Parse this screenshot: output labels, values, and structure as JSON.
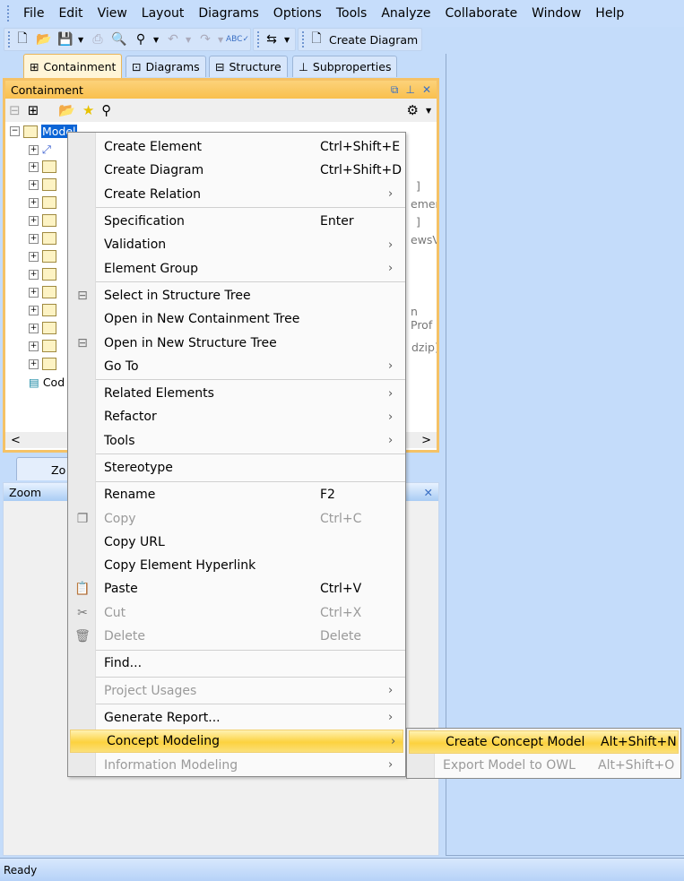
{
  "menubar": [
    "File",
    "Edit",
    "View",
    "Layout",
    "Diagrams",
    "Options",
    "Tools",
    "Analyze",
    "Collaborate",
    "Window",
    "Help"
  ],
  "toolbar": {
    "create_diagram": "Create Diagram"
  },
  "tabs": [
    "Containment",
    "Diagrams",
    "Structure",
    "Subproperties"
  ],
  "panel": {
    "title": "Containment",
    "tree": {
      "root": "Model",
      "last": "Cod"
    },
    "fragments": [
      "]",
      "ement",
      "]",
      "ewsVie",
      "n Prof",
      "dzip]"
    ]
  },
  "zoom": {
    "tab": "Zo",
    "title": "Zoom"
  },
  "status": "Ready",
  "context_menu": [
    {
      "label": "Create Element",
      "shortcut": "Ctrl+Shift+E"
    },
    {
      "label": "Create Diagram",
      "shortcut": "Ctrl+Shift+D"
    },
    {
      "label": "Create Relation",
      "submenu": true
    },
    {
      "sep": true
    },
    {
      "label": "Specification",
      "shortcut": "Enter"
    },
    {
      "label": "Validation",
      "submenu": true
    },
    {
      "label": "Element Group",
      "submenu": true
    },
    {
      "sep": true
    },
    {
      "label": "Select in Structure Tree",
      "icon": "structure-tree-icon"
    },
    {
      "label": "Open in New Containment Tree"
    },
    {
      "label": "Open in New Structure Tree",
      "icon": "structure-tree-icon"
    },
    {
      "label": "Go To",
      "submenu": true
    },
    {
      "sep": true
    },
    {
      "label": "Related Elements",
      "submenu": true
    },
    {
      "label": "Refactor",
      "submenu": true
    },
    {
      "label": "Tools",
      "submenu": true
    },
    {
      "sep": true
    },
    {
      "label": "Stereotype"
    },
    {
      "sep": true
    },
    {
      "label": "Rename",
      "shortcut": "F2"
    },
    {
      "label": "Copy",
      "shortcut": "Ctrl+C",
      "disabled": true,
      "icon": "copy-icon"
    },
    {
      "label": "Copy URL"
    },
    {
      "label": "Copy Element Hyperlink"
    },
    {
      "label": "Paste",
      "shortcut": "Ctrl+V",
      "icon": "paste-icon"
    },
    {
      "label": "Cut",
      "shortcut": "Ctrl+X",
      "disabled": true,
      "icon": "cut-icon"
    },
    {
      "label": "Delete",
      "shortcut": "Delete",
      "disabled": true,
      "icon": "delete-icon"
    },
    {
      "sep": true
    },
    {
      "label": "Find..."
    },
    {
      "sep": true
    },
    {
      "label": "Project Usages",
      "submenu": true,
      "disabled": true
    },
    {
      "sep": true
    },
    {
      "label": "Generate Report...",
      "submenu": true
    },
    {
      "label": "Concept Modeling",
      "submenu": true,
      "highlighted": true
    },
    {
      "label": "Information Modeling",
      "submenu": true,
      "disabled": true
    }
  ],
  "submenu": [
    {
      "label": "Create Concept Model",
      "shortcut": "Alt+Shift+N",
      "highlighted": true
    },
    {
      "label": "Export Model to OWL",
      "shortcut": "Alt+Shift+O",
      "disabled": true
    }
  ],
  "colors": {
    "highlight": "#fcd23f",
    "panel_border": "#f5c266",
    "background": "#c4dcfa"
  }
}
